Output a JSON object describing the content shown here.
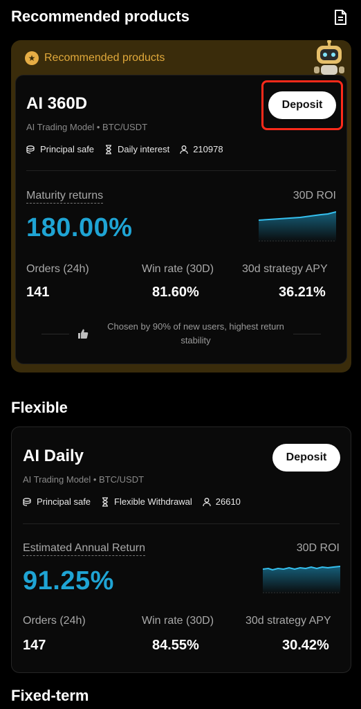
{
  "header": {
    "title": "Recommended products",
    "icon": "document-icon"
  },
  "recommended": {
    "badge_label": "Recommended products",
    "badge_color": "#e1a93b",
    "card": {
      "title": "AI 360D",
      "subtitle": "AI Trading Model • BTC/USDT",
      "tags": [
        "Principal safe",
        "Daily interest",
        "210978"
      ],
      "deposit_label": "Deposit",
      "return_label": "Maturity returns",
      "return_value": "180.00%",
      "roi_label": "30D ROI",
      "stats": [
        {
          "label": "Orders (24h)",
          "value": "141"
        },
        {
          "label": "Win rate (30D)",
          "value": "81.60%"
        },
        {
          "label": "30d strategy APY",
          "value": "36.21%"
        }
      ],
      "note": "Chosen by 90% of new users, highest return stability"
    }
  },
  "flexible": {
    "section_title": "Flexible",
    "card": {
      "title": "AI Daily",
      "subtitle": "AI Trading Model • BTC/USDT",
      "tags": [
        "Principal safe",
        "Flexible Withdrawal",
        "26610"
      ],
      "deposit_label": "Deposit",
      "return_label": "Estimated Annual Return",
      "return_value": "91.25%",
      "roi_label": "30D ROI",
      "stats": [
        {
          "label": "Orders (24h)",
          "value": "147"
        },
        {
          "label": "Win rate (30D)",
          "value": "84.55%"
        },
        {
          "label": "30d strategy APY",
          "value": "30.42%"
        }
      ]
    }
  },
  "fixed_term": {
    "section_title": "Fixed-term"
  },
  "colors": {
    "accent_blue": "#1fa4d4",
    "highlight_red": "#ff2a1a",
    "gold_bg": "#3a2c0b"
  }
}
